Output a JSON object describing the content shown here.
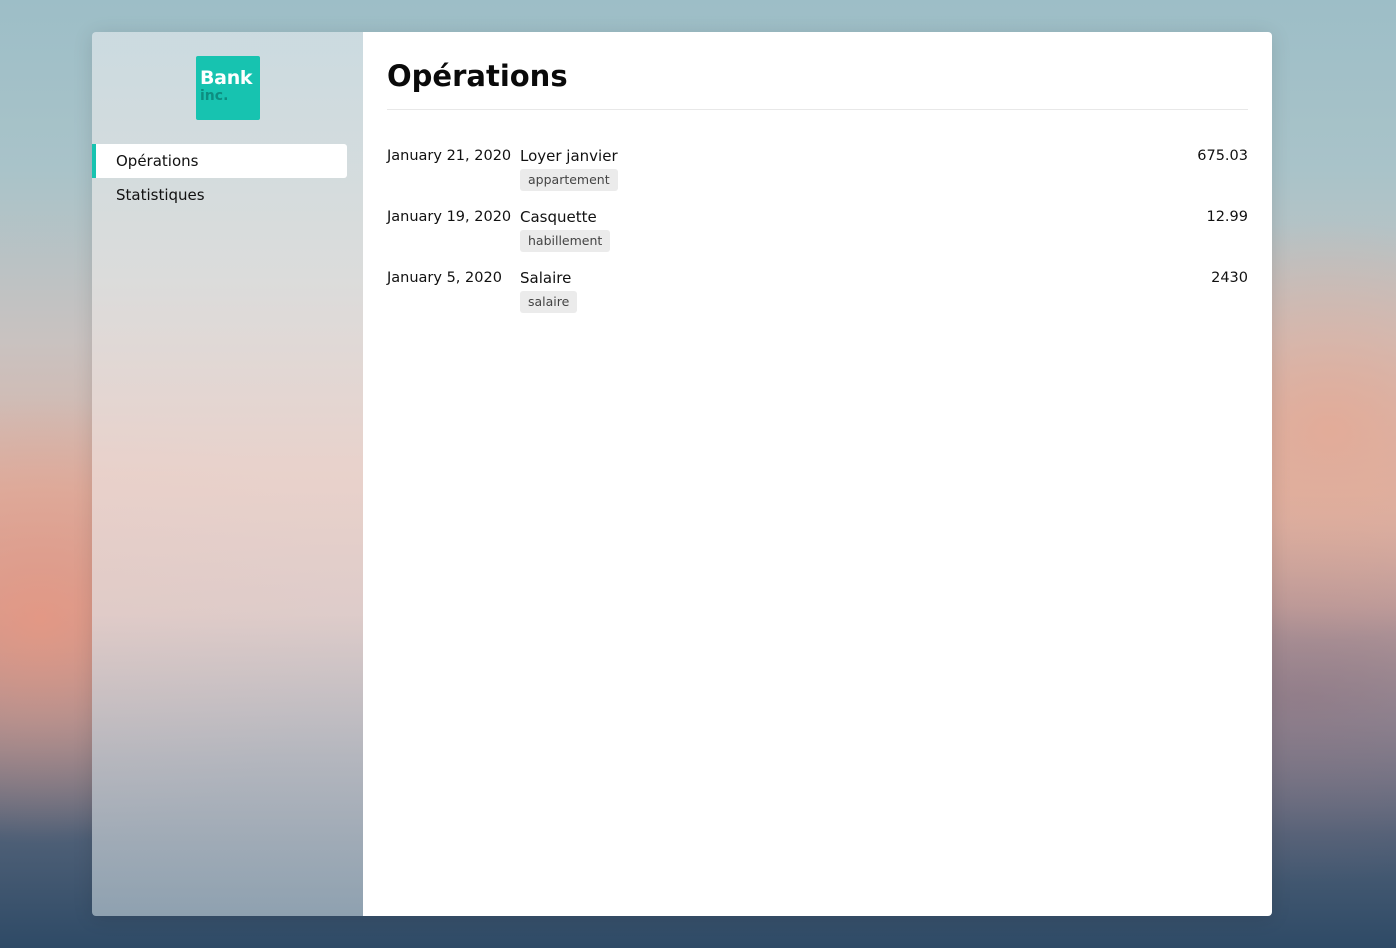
{
  "brand": {
    "line1": "Bank",
    "line2": "inc.",
    "accent": "#17c3b0"
  },
  "sidebar": {
    "items": [
      {
        "label": "Opérations",
        "active": true
      },
      {
        "label": "Statistiques",
        "active": false
      }
    ]
  },
  "main": {
    "title": "Opérations",
    "operations": [
      {
        "date": "January 21, 2020",
        "label": "Loyer janvier",
        "tag": "appartement",
        "amount": "675.03"
      },
      {
        "date": "January 19, 2020",
        "label": "Casquette",
        "tag": "habillement",
        "amount": "12.99"
      },
      {
        "date": "January 5, 2020",
        "label": "Salaire",
        "tag": "salaire",
        "amount": "2430"
      }
    ]
  }
}
